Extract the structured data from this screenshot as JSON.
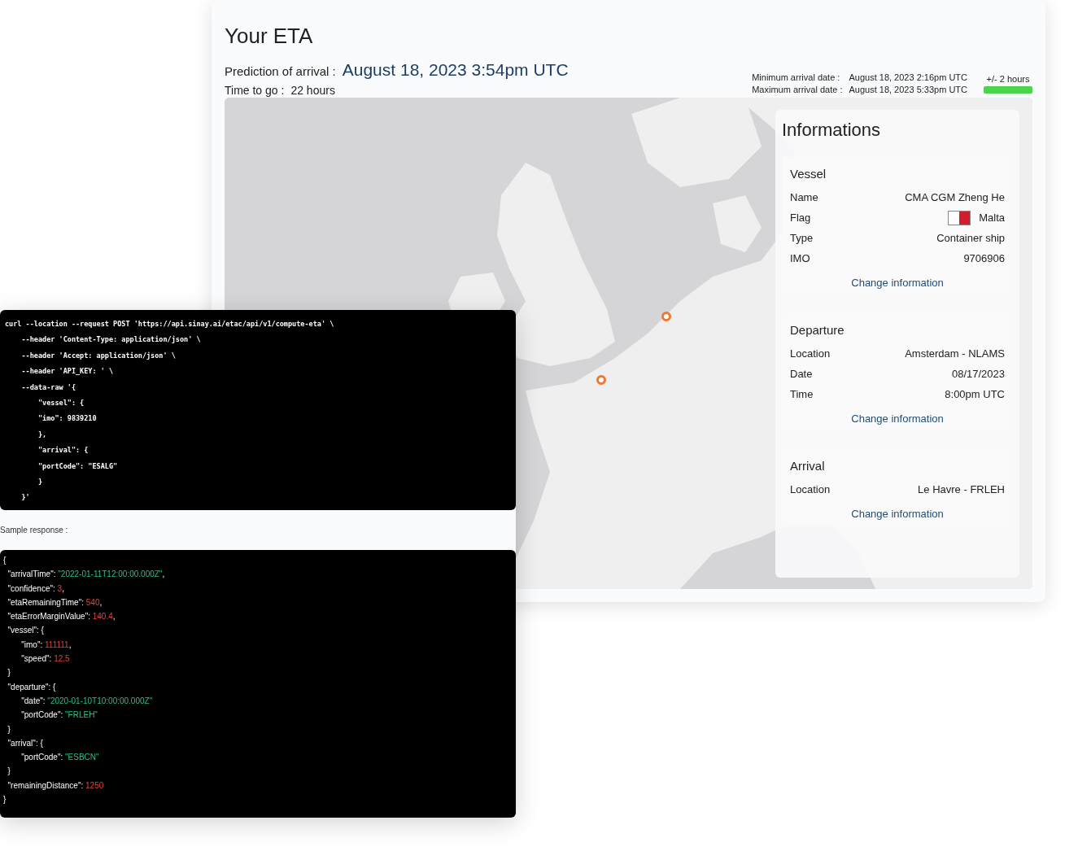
{
  "title": "Your ETA",
  "prediction": {
    "label": "Prediction of arrival :",
    "value": "August 18, 2023 3:54pm UTC"
  },
  "time_to_go": {
    "label": "Time to go :",
    "value": "22 hours"
  },
  "range": [
    {
      "label": "Minimum arrival date :",
      "value": "August 18, 2023 2:16pm UTC"
    },
    {
      "label": "Maximum arrival date :",
      "value": "August 18, 2023 5:33pm UTC"
    }
  ],
  "margin": {
    "label": "+/- 2 hours",
    "level": 1
  },
  "info_panel": {
    "title": "Informations",
    "sections": [
      {
        "title": "Vessel",
        "rows": [
          {
            "label": "Name",
            "value": "CMA CGM Zheng He"
          },
          {
            "label": "Flag",
            "value": "Malta",
            "kind": "flag"
          },
          {
            "label": "Type",
            "value": "Container ship"
          },
          {
            "label": "IMO",
            "value": "9706906"
          }
        ],
        "link": "Change information"
      },
      {
        "title": "Departure",
        "rows": [
          {
            "label": "Location",
            "value": "Amsterdam - NLAMS"
          },
          {
            "label": "Date",
            "value": "08/17/2023"
          },
          {
            "label": "Time",
            "value": "8:00pm UTC"
          }
        ],
        "link": "Change information"
      },
      {
        "title": "Arrival",
        "rows": [
          {
            "label": "Location",
            "value": "Le Havre - FRLEH"
          }
        ],
        "link": "Change information"
      }
    ]
  },
  "request_code": [
    "curl --location --request POST 'https://api.sinay.ai/etac/api/v1/compute-eta' \\",
    "    --header 'Content-Type: application/json' \\",
    "    --header 'Accept: application/json' \\",
    "    --header 'API_KEY: ' \\",
    "    --data-raw '{",
    "        \"vessel\": {",
    "        \"imo\": 9839210",
    "        },",
    "        \"arrival\": {",
    "        \"portCode\": \"ESALG\"",
    "        }",
    "    }'"
  ],
  "response_label": "Sample response :",
  "response_code": [
    [
      {
        "text": "{",
        "kind": "punct"
      }
    ],
    [
      {
        "text": "  \"arrivalTime\": ",
        "kind": "key"
      },
      {
        "text": "\"2022-01-11T12:00:00.000Z\"",
        "kind": "string"
      },
      {
        "text": ",",
        "kind": "punct"
      }
    ],
    [
      {
        "text": "  \"confidence\": ",
        "kind": "key"
      },
      {
        "text": "3",
        "kind": "number"
      },
      {
        "text": ",",
        "kind": "punct"
      }
    ],
    [
      {
        "text": "  \"etaRemainingTime\": ",
        "kind": "key"
      },
      {
        "text": "540",
        "kind": "number"
      },
      {
        "text": ",",
        "kind": "punct"
      }
    ],
    [
      {
        "text": "  \"etaErrorMarginValue\": ",
        "kind": "key"
      },
      {
        "text": "140.4",
        "kind": "number"
      },
      {
        "text": ",",
        "kind": "punct"
      }
    ],
    [
      {
        "text": "  \"vessel\": {",
        "kind": "key"
      }
    ],
    [
      {
        "text": "        \"imo\": ",
        "kind": "key"
      },
      {
        "text": "111111",
        "kind": "number"
      },
      {
        "text": ",",
        "kind": "punct"
      }
    ],
    [
      {
        "text": "        \"speed\": ",
        "kind": "key"
      },
      {
        "text": "12.5",
        "kind": "number"
      }
    ],
    [
      {
        "text": "  }",
        "kind": "punct"
      }
    ],
    [
      {
        "text": "  \"departure\": {",
        "kind": "key"
      }
    ],
    [
      {
        "text": "        \"date\": ",
        "kind": "key"
      },
      {
        "text": "\"2020-01-10T10:00:00.000Z\"",
        "kind": "string"
      }
    ],
    [
      {
        "text": "        \"portCode\": ",
        "kind": "key"
      },
      {
        "text": "\"FRLEH\"",
        "kind": "string"
      }
    ],
    [
      {
        "text": "  }",
        "kind": "punct"
      }
    ],
    [
      {
        "text": "  \"arrival\": {",
        "kind": "key"
      }
    ],
    [
      {
        "text": "        \"portCode\": ",
        "kind": "key"
      },
      {
        "text": "\"ESBCN\"",
        "kind": "string"
      }
    ],
    [
      {
        "text": "  }",
        "kind": "punct"
      }
    ],
    [
      {
        "text": "  \"remainingDistance\": ",
        "kind": "key"
      },
      {
        "text": "1250",
        "kind": "number"
      }
    ],
    [
      {
        "text": "}",
        "kind": "punct"
      }
    ]
  ]
}
